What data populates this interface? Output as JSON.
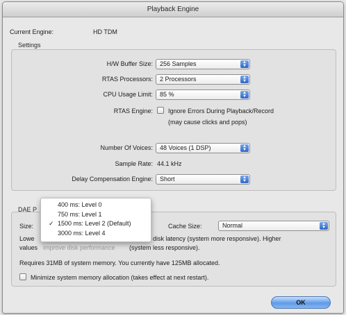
{
  "window": {
    "title": "Playback Engine"
  },
  "current_engine": {
    "label": "Current Engine:",
    "value": "HD TDM"
  },
  "settings": {
    "section_label": "Settings",
    "hw_buffer_size": {
      "label": "H/W Buffer Size:",
      "value": "256 Samples"
    },
    "rtas_processors": {
      "label": "RTAS Processors:",
      "value": "2 Processors"
    },
    "cpu_usage_limit": {
      "label": "CPU Usage Limit:",
      "value": "85 %"
    },
    "rtas_engine": {
      "label": "RTAS Engine:",
      "checkbox_label": "Ignore Errors During Playback/Record",
      "note": "(may cause clicks and pops)",
      "checked": false
    },
    "number_of_voices": {
      "label": "Number Of Voices:",
      "value": "48 Voices (1 DSP)"
    },
    "sample_rate": {
      "label": "Sample Rate:",
      "value": "44.1 kHz"
    },
    "delay_compensation_engine": {
      "label": "Delay Compensation Engine:",
      "value": "Short"
    }
  },
  "dae": {
    "section_label": "DAE P",
    "size_label": "Size:",
    "size_menu": {
      "options": [
        {
          "label": "400 ms: Level 0",
          "selected": false
        },
        {
          "label": "750 ms: Level 1",
          "selected": false
        },
        {
          "label": "1500 ms: Level 2 (Default)",
          "selected": true
        },
        {
          "label": "3000 ms: Level 4",
          "selected": false
        }
      ],
      "check_glyph": "✓"
    },
    "cache_size": {
      "label": "Cache Size:",
      "value": "Normal"
    },
    "description_line1_left": "Lowe",
    "description_line1_right": "disk latency (system more responsive). Higher",
    "description_line2_left": "values",
    "description_line2_hidden": "improve disk performance",
    "description_line2_right": "(system less responsive).",
    "memory_note": "Requires 31MB of system memory. You currently have 125MB allocated.",
    "minimize_checkbox": {
      "label": "Minimize system memory allocation (takes effect at next restart).",
      "checked": false
    }
  },
  "buttons": {
    "ok": "OK"
  },
  "icons": {
    "popup_arrows": "▲▼"
  }
}
